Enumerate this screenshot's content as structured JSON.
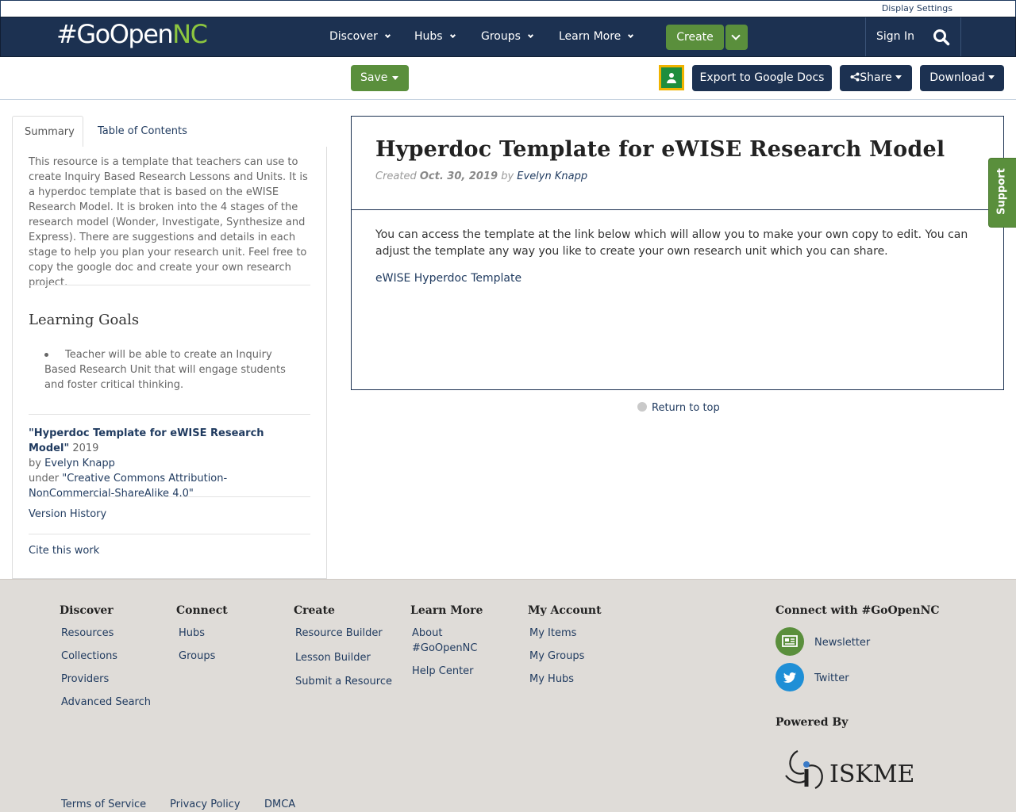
{
  "utility": {
    "display_settings": "Display Settings"
  },
  "navbar": {
    "logo_prefix": "#GoOpen",
    "logo_suffix": "NC",
    "items": [
      {
        "label": "Discover"
      },
      {
        "label": "Hubs"
      },
      {
        "label": "Groups"
      },
      {
        "label": "Learn More"
      }
    ],
    "create_label": "Create",
    "sign_in": "Sign In"
  },
  "actions": {
    "save": "Save",
    "export": "Export to Google Docs",
    "share": "Share",
    "download": "Download"
  },
  "tabs": {
    "summary": "Summary",
    "toc": "Table of Contents"
  },
  "sidebar": {
    "summary_text": "This resource is a template that teachers can use to create Inquiry Based Research Lessons and Units. It is a hyperdoc template that is based on the eWISE Research Model. It is broken into the 4 stages of the research model (Wonder, Investigate, Synthesize and Express). There are suggestions and details in each stage to help you plan your research unit. Feel free to copy the google doc and create your own research project.",
    "learning_goals_title": "Learning Goals",
    "goal_1": "Teacher will be able to create an Inquiry Based Research Unit that will engage students and foster critical thinking.",
    "attr_title": "\"Hyperdoc Template for eWISE Research Model\"",
    "attr_year": " 2019",
    "attr_by": "by ",
    "attr_author": "Evelyn Knapp",
    "attr_under": "under ",
    "attr_license": "\"Creative Commons Attribution-NonCommercial-ShareAlike 4.0\"",
    "version_history": "Version History",
    "cite": "Cite this work"
  },
  "main": {
    "title": "Hyperdoc Template for eWISE Research Model",
    "created_label": "Created ",
    "created_date": "Oct. 30, 2019",
    "by_label": " by ",
    "author": "Evelyn Knapp",
    "body": "You can access the template at the link below which will allow you to make your own copy to edit.  You can adjust the template any way you like to create your own research unit which you can share.",
    "link": "eWISE Hyperdoc Template",
    "return_top": "Return to top"
  },
  "support": "Support",
  "footer": {
    "discover": {
      "title": "Discover",
      "links": [
        "Resources",
        "Collections",
        "Providers",
        "Advanced Search"
      ]
    },
    "connect": {
      "title": "Connect",
      "links": [
        "Hubs",
        "Groups"
      ]
    },
    "create": {
      "title": "Create",
      "links": [
        "Resource Builder",
        "Lesson Builder",
        "Submit a Resource"
      ]
    },
    "learn": {
      "title": "Learn More",
      "links": [
        "About #GoOpenNC",
        "Help Center"
      ]
    },
    "account": {
      "title": "My Account",
      "links": [
        "My Items",
        "My Groups",
        "My Hubs"
      ]
    },
    "connect_with": "Connect with #GoOpenNC",
    "newsletter": "Newsletter",
    "twitter": "Twitter",
    "powered_by": "Powered By",
    "iskme": "ISKME",
    "bottom": [
      "Terms of Service",
      "Privacy Policy",
      "DMCA"
    ],
    "colors": {
      "newsletter": "#5a8f3c",
      "twitter": "#1f8fd6"
    }
  }
}
